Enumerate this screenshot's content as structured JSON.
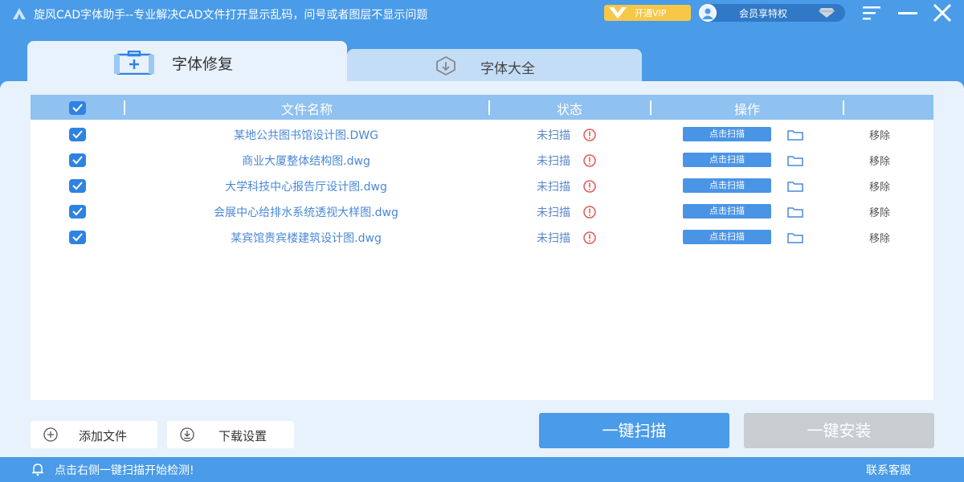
{
  "app": {
    "title": "旋风CAD字体助手--专业解决CAD文件打开显示乱码，问号或者图层不显示问题",
    "vip_label": "开通VIP",
    "member_label": "会员享特权"
  },
  "tabs": [
    {
      "label": "字体修复",
      "active": true
    },
    {
      "label": "字体大全",
      "active": false
    }
  ],
  "table": {
    "columns": [
      "文件名称",
      "状态",
      "操作"
    ],
    "header_checked": true,
    "scan_button_label": "点击扫描",
    "remove_label": "移除",
    "rows": [
      {
        "checked": true,
        "name": "某地公共图书馆设计图.DWG",
        "status": "未扫描"
      },
      {
        "checked": true,
        "name": "商业大厦整体结构图.dwg",
        "status": "未扫描"
      },
      {
        "checked": true,
        "name": "大学科技中心报告厅设计图.dwg",
        "status": "未扫描"
      },
      {
        "checked": true,
        "name": "会展中心给排水系统透视大样图.dwg",
        "status": "未扫描"
      },
      {
        "checked": true,
        "name": "某宾馆贵宾楼建筑设计图.dwg",
        "status": "未扫描"
      }
    ]
  },
  "actions": {
    "add_file": "添加文件",
    "download_settings": "下载设置",
    "scan_all": "一键扫描",
    "install_all": "一键安装"
  },
  "statusbar": {
    "message": "点击右侧一键扫描开始检测!",
    "contact": "联系客服"
  },
  "colors": {
    "brand": "#4a9be8",
    "header": "#8fc1f1",
    "status_warning": "#e05a5a",
    "disabled": "#c8cdd2",
    "vip": "#f7c848"
  },
  "icons": {
    "status": "warning-icon",
    "row_folder": "folder-icon",
    "repair_tab": "toolbox-icon",
    "library_tab": "font-library-icon"
  }
}
